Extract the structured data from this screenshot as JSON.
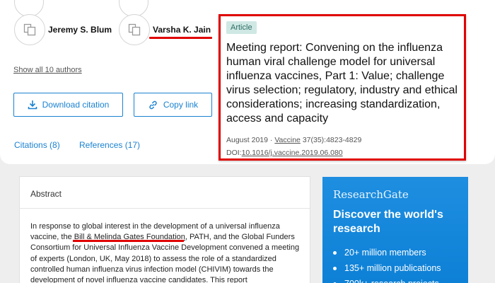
{
  "authors": [
    {
      "name": "Jeremy S. Blum"
    },
    {
      "name": "Varsha K. Jain"
    }
  ],
  "show_all_authors": "Show all 10 authors",
  "buttons": {
    "download_citation": "Download citation",
    "copy_link": "Copy link"
  },
  "tabs": {
    "citations": "Citations (8)",
    "references": "References (17)"
  },
  "article": {
    "tag": "Article",
    "title": "Meeting report: Convening on the influenza human viral challenge model for universal influenza vaccines, Part 1: Value; challenge virus selection; regulatory, industry and ethical considerations; increasing standardization, access and capacity",
    "date": "August 2019 ·",
    "journal": "Vaccine",
    "volume": "37(35):4823-4829",
    "doi_label": "DOI:",
    "doi": "10.1016/j.vaccine.2019.06.080"
  },
  "abstract": {
    "heading": "Abstract",
    "text_before": "In response to global interest in the development of a universal influenza vaccine, the ",
    "highlight": "Bill & Melinda Gates Foundation",
    "text_after": ", PATH, and the Global Funders Consortium for Universal Influenza Vaccine Development convened a meeting of experts (London, UK, May 2018) to assess the role of a standardized controlled human influenza virus infection model (CHIVIM) towards the development of novel influenza vaccine candidates. This report"
  },
  "researchgate": {
    "brand": "ResearchGate",
    "headline": "Discover the world's research",
    "items": [
      "20+ million members",
      "135+ million publications",
      "700k+ research projects"
    ]
  },
  "colors": {
    "accent_blue": "#1a82d1",
    "highlight_red": "#e00000",
    "tag_bg": "#cfe8e4"
  }
}
